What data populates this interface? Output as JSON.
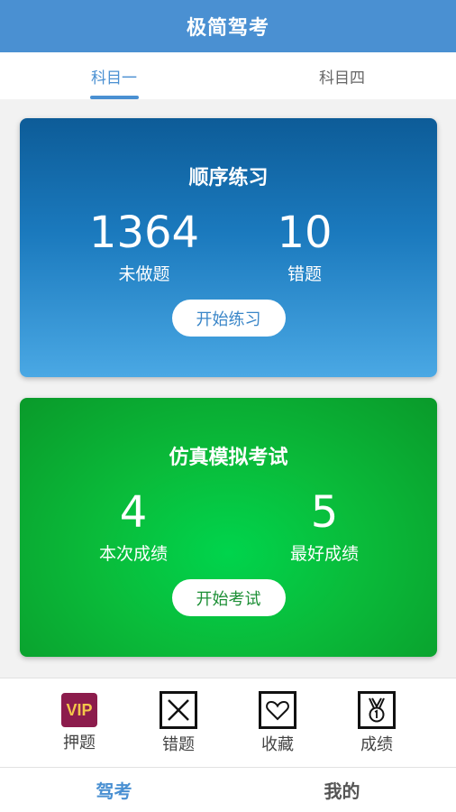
{
  "header": {
    "title": "极简驾考"
  },
  "subject_tabs": [
    {
      "label": "科目一",
      "active": true
    },
    {
      "label": "科目四",
      "active": false
    }
  ],
  "practice_card": {
    "title": "顺序练习",
    "stats": [
      {
        "value": "1364",
        "label": "未做题"
      },
      {
        "value": "10",
        "label": "错题"
      }
    ],
    "button_label": "开始练习"
  },
  "exam_card": {
    "title": "仿真模拟考试",
    "stats": [
      {
        "value": "4",
        "label": "本次成绩"
      },
      {
        "value": "5",
        "label": "最好成绩"
      }
    ],
    "button_label": "开始考试"
  },
  "tools": [
    {
      "label": "押题",
      "icon": "vip-icon",
      "badge_text": "VIP"
    },
    {
      "label": "错题",
      "icon": "x-box-icon"
    },
    {
      "label": "收藏",
      "icon": "heart-icon"
    },
    {
      "label": "成绩",
      "icon": "medal-icon"
    }
  ],
  "bottom_nav": [
    {
      "label": "驾考",
      "active": true
    },
    {
      "label": "我的",
      "active": false
    }
  ],
  "colors": {
    "primary": "#4a90d2",
    "practice_card": "#1b7abe",
    "exam_card": "#0abb3a",
    "vip_bg": "#8c1c4c",
    "vip_text": "#f4c64a"
  }
}
